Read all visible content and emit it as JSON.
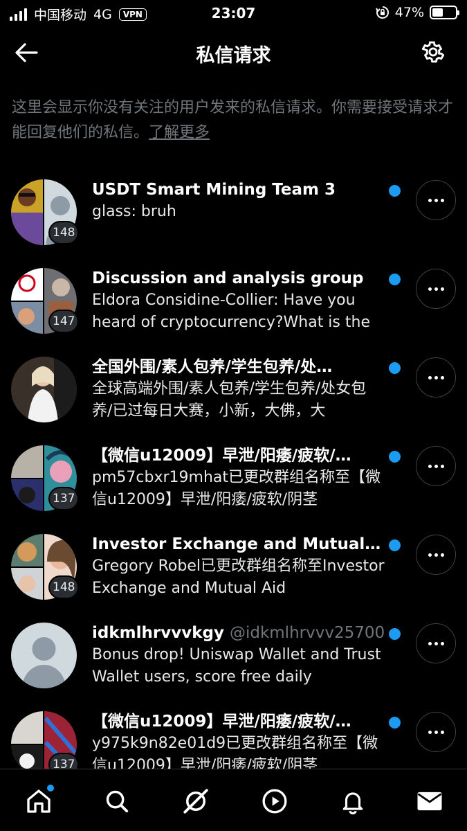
{
  "status_bar": {
    "carrier": "中国移动",
    "network": "4G",
    "vpn": "VPN",
    "time": "23:07",
    "battery_text": "47%",
    "battery_level": 0.47
  },
  "nav": {
    "title": "私信请求",
    "back_icon": "arrow-left-icon",
    "settings_icon": "gear-icon"
  },
  "notice": {
    "text": "这里会显示你没有关注的用户发来的私信请求。你需要接受请求才能回复他们的私信。",
    "link": "了解更多"
  },
  "requests": [
    {
      "name": "USDT Smart Mining Team 3",
      "handle": "",
      "preview": "glass: bruh",
      "count": "148",
      "unread": true
    },
    {
      "name": "Discussion and analysis group",
      "handle": "",
      "preview": "Eldora Considine-Collier: Have you heard of cryptocurrency?What is the",
      "count": "147",
      "unread": true
    },
    {
      "name": "全国外围/素人包养/学生包养/处…",
      "handle": "",
      "preview": "全球高端外围/素人包养/学生包养/处女包养/已过每日大赛，小新，大佛，大",
      "count": "",
      "unread": true
    },
    {
      "name": "【微信u12009】早泄/阳痿/疲软/…",
      "handle": "",
      "preview": "pm57cbxr19mhat已更改群组名称至【微信u12009】早泄/阳痿/疲软/阴茎",
      "count": "137",
      "unread": true
    },
    {
      "name": "Investor Exchange and Mutual Ai…",
      "handle": "",
      "preview": "Gregory Robel已更改群组名称至Investor Exchange and Mutual Aid",
      "count": "148",
      "unread": true
    },
    {
      "name": "idkmlhrvvvkgy",
      "handle": "@idkmlhrvvv25700",
      "preview": "Bonus drop! Uniswap Wallet and Trust Wallet users, score free daily",
      "count": "",
      "unread": true
    },
    {
      "name": "【微信u12009】早泄/阳痿/疲软/…",
      "handle": "",
      "preview": "y975k9n82e01d9已更改群组名称至【微信u12009】早泄/阳痿/疲软/阴茎",
      "count": "137",
      "unread": true
    }
  ],
  "tab_bar": {
    "items": [
      "home-icon",
      "search-icon",
      "grok-icon",
      "video-icon",
      "bell-icon",
      "mail-icon"
    ],
    "home_has_dot": true
  },
  "colors": {
    "background": "#000000",
    "accent": "#1d9bf0",
    "muted_text": "#71767b"
  }
}
